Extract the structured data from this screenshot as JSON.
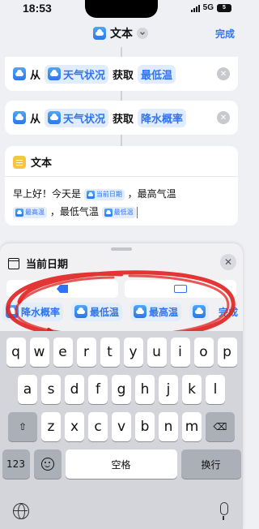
{
  "status": {
    "time": "18:53",
    "network": "5G",
    "battery": "5"
  },
  "nav": {
    "title": "文本",
    "done": "完成"
  },
  "actions": [
    {
      "from": "从",
      "app": "天气状况",
      "verb": "获取",
      "field": "最低温"
    },
    {
      "from": "从",
      "app": "天气状况",
      "verb": "获取",
      "field": "降水概率"
    }
  ],
  "text_action": {
    "title": "文本",
    "body_1": "早上好！今天是",
    "var_date": "当前日期",
    "body_2": "，最高气温",
    "var_high": "最高温",
    "body_3": "，最低气温",
    "var_low": "最低温"
  },
  "sheet": {
    "title": "当前日期"
  },
  "variable_bar": {
    "items": [
      "降水概率",
      "最低温",
      "最高温"
    ],
    "done": "完成"
  },
  "keyboard": {
    "row1": [
      "q",
      "w",
      "e",
      "r",
      "t",
      "y",
      "u",
      "i",
      "o",
      "p"
    ],
    "row2": [
      "a",
      "s",
      "d",
      "f",
      "g",
      "h",
      "j",
      "k",
      "l"
    ],
    "row3": [
      "z",
      "x",
      "c",
      "v",
      "b",
      "n",
      "m"
    ],
    "num_key": "123",
    "space": "空格",
    "return": "换行"
  },
  "colors": {
    "accent": "#2f74f6",
    "annotation": "#e0201f"
  }
}
